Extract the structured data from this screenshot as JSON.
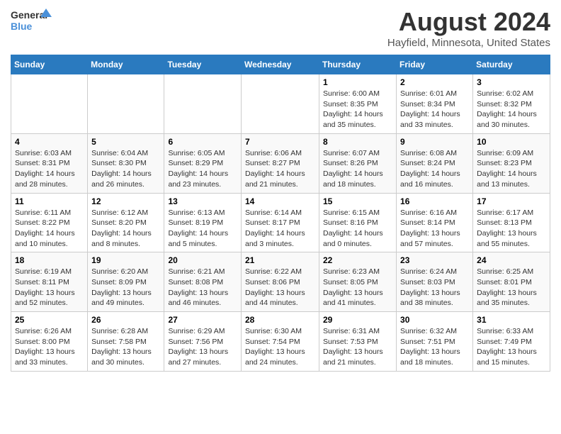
{
  "logo": {
    "line1": "General",
    "line2": "Blue"
  },
  "title": "August 2024",
  "subtitle": "Hayfield, Minnesota, United States",
  "days_of_week": [
    "Sunday",
    "Monday",
    "Tuesday",
    "Wednesday",
    "Thursday",
    "Friday",
    "Saturday"
  ],
  "weeks": [
    [
      {
        "day": "",
        "info": ""
      },
      {
        "day": "",
        "info": ""
      },
      {
        "day": "",
        "info": ""
      },
      {
        "day": "",
        "info": ""
      },
      {
        "day": "1",
        "info": "Sunrise: 6:00 AM\nSunset: 8:35 PM\nDaylight: 14 hours and 35 minutes."
      },
      {
        "day": "2",
        "info": "Sunrise: 6:01 AM\nSunset: 8:34 PM\nDaylight: 14 hours and 33 minutes."
      },
      {
        "day": "3",
        "info": "Sunrise: 6:02 AM\nSunset: 8:32 PM\nDaylight: 14 hours and 30 minutes."
      }
    ],
    [
      {
        "day": "4",
        "info": "Sunrise: 6:03 AM\nSunset: 8:31 PM\nDaylight: 14 hours and 28 minutes."
      },
      {
        "day": "5",
        "info": "Sunrise: 6:04 AM\nSunset: 8:30 PM\nDaylight: 14 hours and 26 minutes."
      },
      {
        "day": "6",
        "info": "Sunrise: 6:05 AM\nSunset: 8:29 PM\nDaylight: 14 hours and 23 minutes."
      },
      {
        "day": "7",
        "info": "Sunrise: 6:06 AM\nSunset: 8:27 PM\nDaylight: 14 hours and 21 minutes."
      },
      {
        "day": "8",
        "info": "Sunrise: 6:07 AM\nSunset: 8:26 PM\nDaylight: 14 hours and 18 minutes."
      },
      {
        "day": "9",
        "info": "Sunrise: 6:08 AM\nSunset: 8:24 PM\nDaylight: 14 hours and 16 minutes."
      },
      {
        "day": "10",
        "info": "Sunrise: 6:09 AM\nSunset: 8:23 PM\nDaylight: 14 hours and 13 minutes."
      }
    ],
    [
      {
        "day": "11",
        "info": "Sunrise: 6:11 AM\nSunset: 8:22 PM\nDaylight: 14 hours and 10 minutes."
      },
      {
        "day": "12",
        "info": "Sunrise: 6:12 AM\nSunset: 8:20 PM\nDaylight: 14 hours and 8 minutes."
      },
      {
        "day": "13",
        "info": "Sunrise: 6:13 AM\nSunset: 8:19 PM\nDaylight: 14 hours and 5 minutes."
      },
      {
        "day": "14",
        "info": "Sunrise: 6:14 AM\nSunset: 8:17 PM\nDaylight: 14 hours and 3 minutes."
      },
      {
        "day": "15",
        "info": "Sunrise: 6:15 AM\nSunset: 8:16 PM\nDaylight: 14 hours and 0 minutes."
      },
      {
        "day": "16",
        "info": "Sunrise: 6:16 AM\nSunset: 8:14 PM\nDaylight: 13 hours and 57 minutes."
      },
      {
        "day": "17",
        "info": "Sunrise: 6:17 AM\nSunset: 8:13 PM\nDaylight: 13 hours and 55 minutes."
      }
    ],
    [
      {
        "day": "18",
        "info": "Sunrise: 6:19 AM\nSunset: 8:11 PM\nDaylight: 13 hours and 52 minutes."
      },
      {
        "day": "19",
        "info": "Sunrise: 6:20 AM\nSunset: 8:09 PM\nDaylight: 13 hours and 49 minutes."
      },
      {
        "day": "20",
        "info": "Sunrise: 6:21 AM\nSunset: 8:08 PM\nDaylight: 13 hours and 46 minutes."
      },
      {
        "day": "21",
        "info": "Sunrise: 6:22 AM\nSunset: 8:06 PM\nDaylight: 13 hours and 44 minutes."
      },
      {
        "day": "22",
        "info": "Sunrise: 6:23 AM\nSunset: 8:05 PM\nDaylight: 13 hours and 41 minutes."
      },
      {
        "day": "23",
        "info": "Sunrise: 6:24 AM\nSunset: 8:03 PM\nDaylight: 13 hours and 38 minutes."
      },
      {
        "day": "24",
        "info": "Sunrise: 6:25 AM\nSunset: 8:01 PM\nDaylight: 13 hours and 35 minutes."
      }
    ],
    [
      {
        "day": "25",
        "info": "Sunrise: 6:26 AM\nSunset: 8:00 PM\nDaylight: 13 hours and 33 minutes."
      },
      {
        "day": "26",
        "info": "Sunrise: 6:28 AM\nSunset: 7:58 PM\nDaylight: 13 hours and 30 minutes."
      },
      {
        "day": "27",
        "info": "Sunrise: 6:29 AM\nSunset: 7:56 PM\nDaylight: 13 hours and 27 minutes."
      },
      {
        "day": "28",
        "info": "Sunrise: 6:30 AM\nSunset: 7:54 PM\nDaylight: 13 hours and 24 minutes."
      },
      {
        "day": "29",
        "info": "Sunrise: 6:31 AM\nSunset: 7:53 PM\nDaylight: 13 hours and 21 minutes."
      },
      {
        "day": "30",
        "info": "Sunrise: 6:32 AM\nSunset: 7:51 PM\nDaylight: 13 hours and 18 minutes."
      },
      {
        "day": "31",
        "info": "Sunrise: 6:33 AM\nSunset: 7:49 PM\nDaylight: 13 hours and 15 minutes."
      }
    ]
  ]
}
